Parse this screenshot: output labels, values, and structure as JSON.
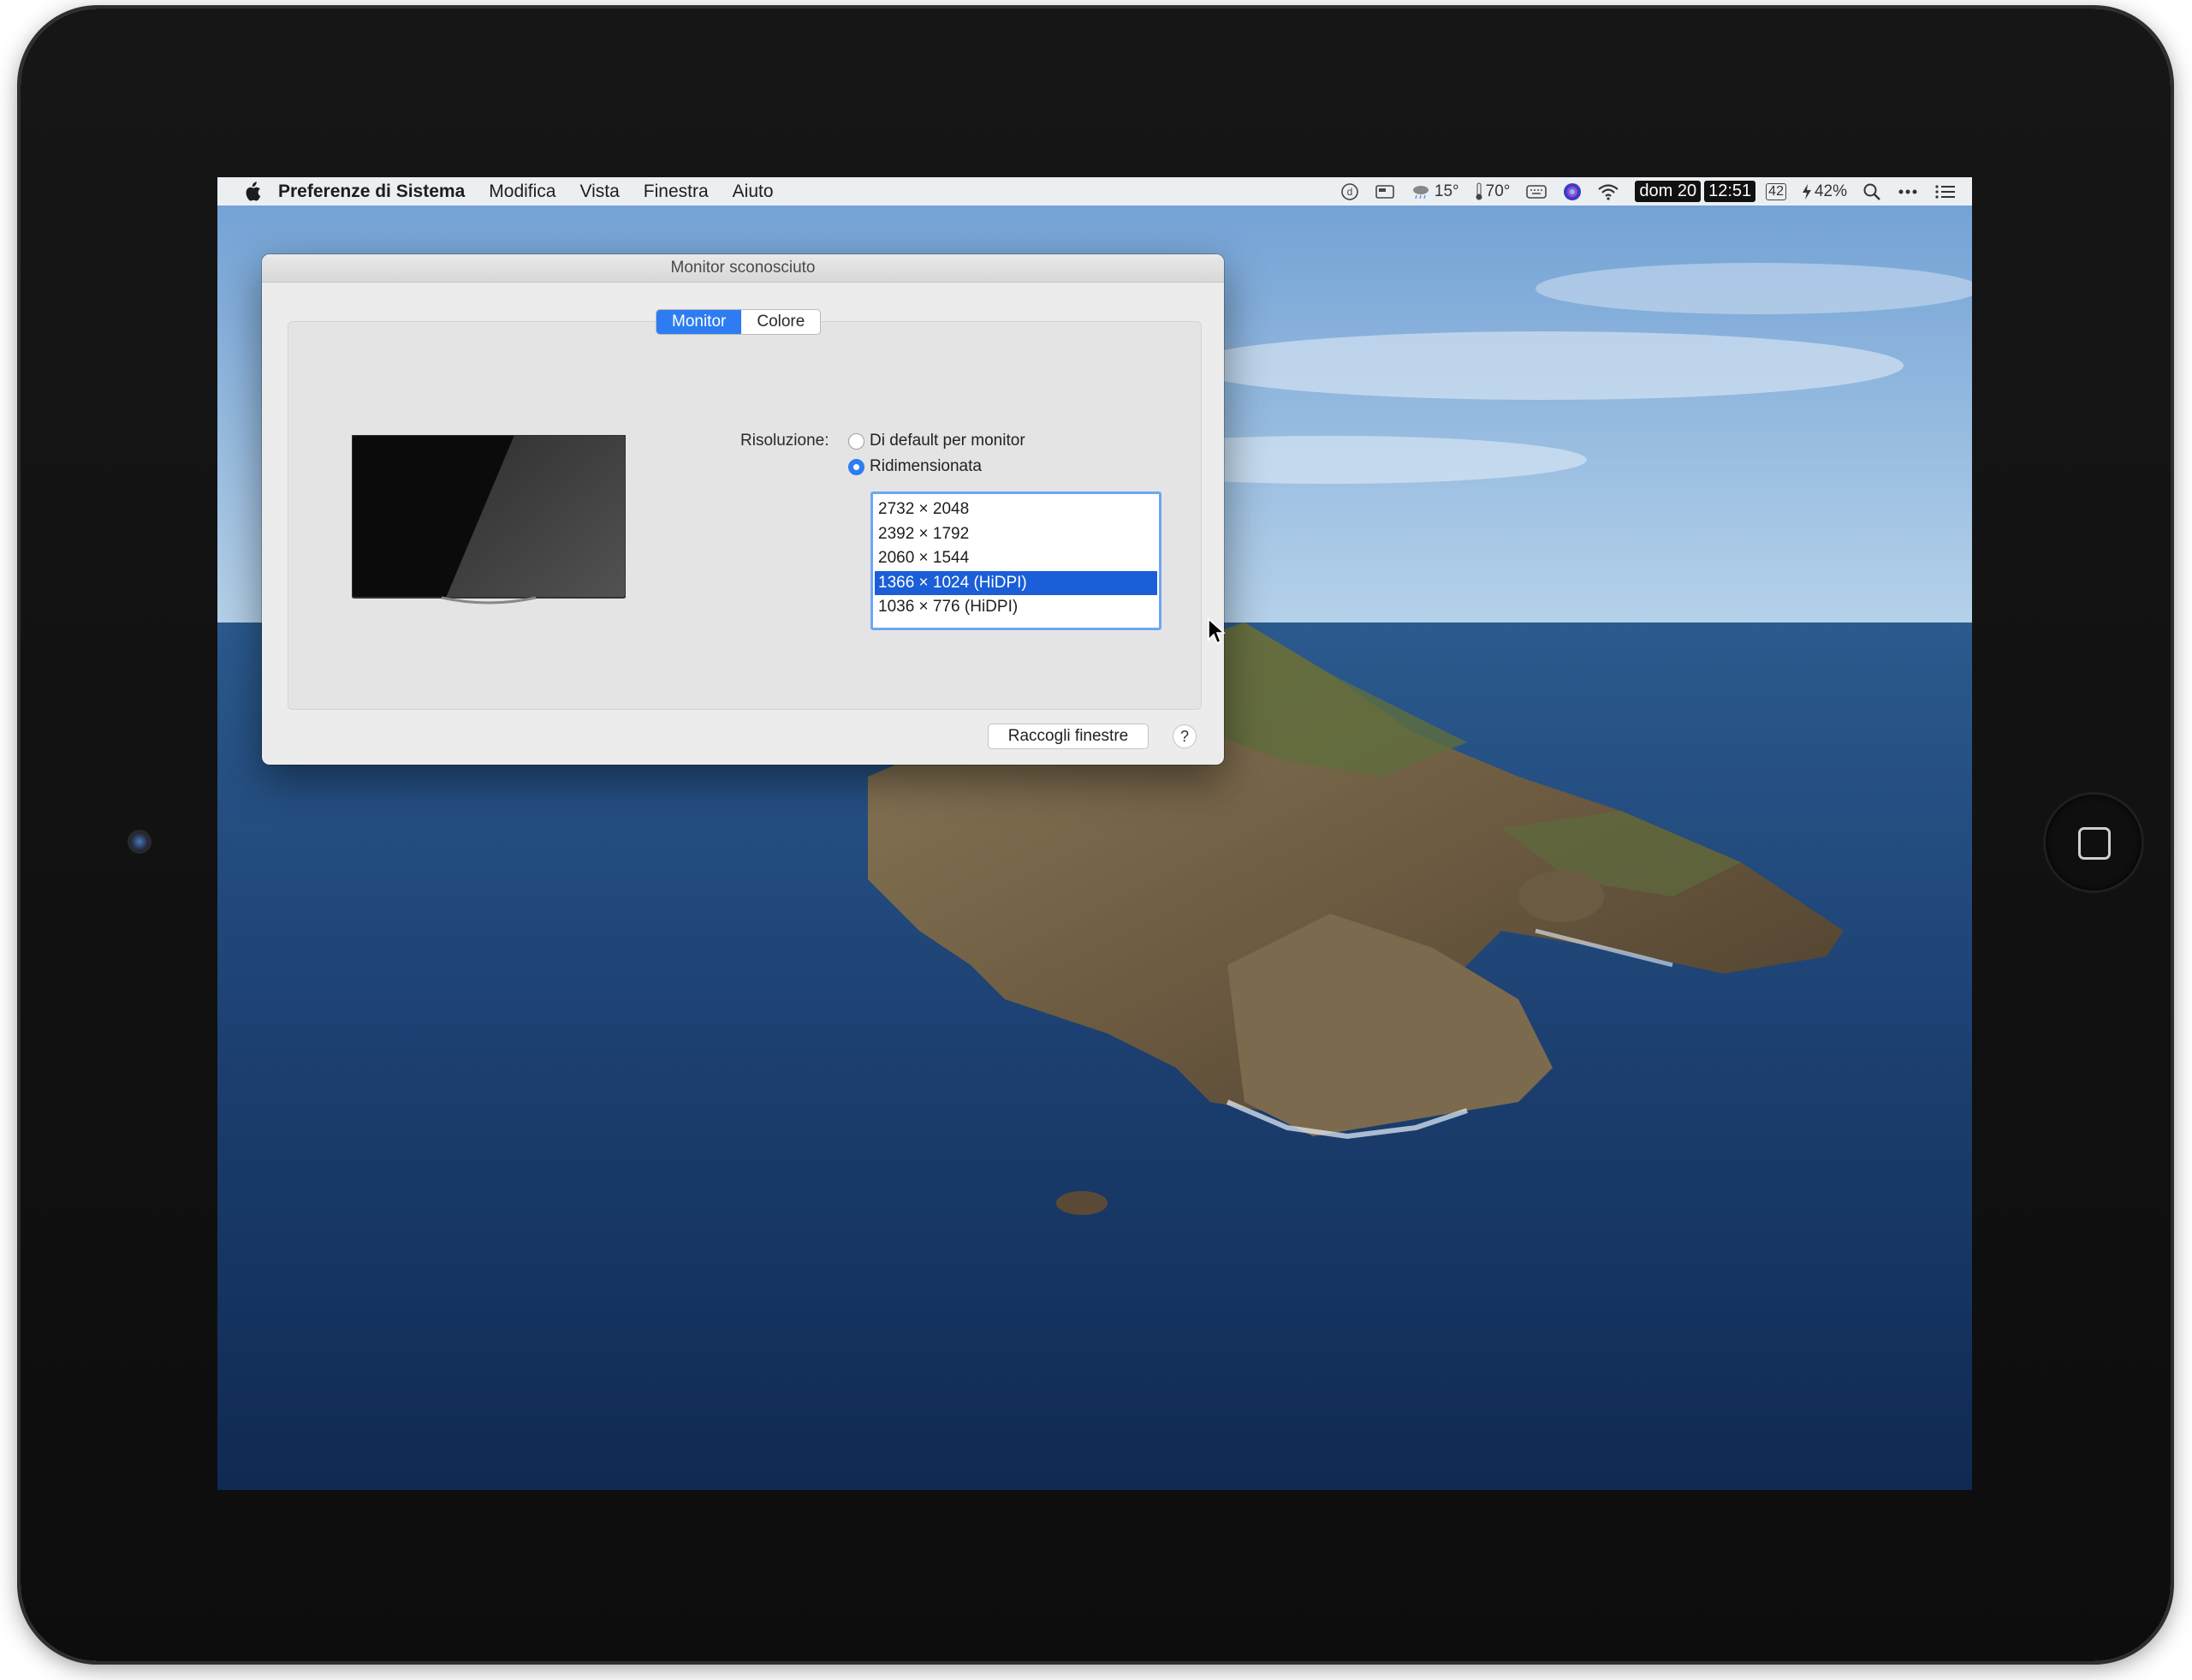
{
  "menubar": {
    "app_name": "Preferenze di Sistema",
    "menus": [
      "Modifica",
      "Vista",
      "Finestra",
      "Aiuto"
    ],
    "status": {
      "weather_temp": "15°",
      "sensor_temp": "70°",
      "date": "dom 20",
      "time": "12:51",
      "calendar_day": "42",
      "battery": "42%"
    }
  },
  "window": {
    "title": "Monitor sconosciuto",
    "tabs": [
      {
        "label": "Monitor",
        "active": true
      },
      {
        "label": "Colore",
        "active": false
      }
    ],
    "resolution_label": "Risoluzione:",
    "options": {
      "default": "Di default per monitor",
      "scaled": "Ridimensionata"
    },
    "selected_option": "scaled",
    "resolutions": [
      "2732 × 2048",
      "2392 × 1792",
      "2060 × 1544",
      "1366 × 1024 (HiDPI)",
      "1036 × 776 (HiDPI)"
    ],
    "selected_resolution": "1366 × 1024 (HiDPI)",
    "gather_button": "Raccogli finestre",
    "help_button": "?"
  },
  "colors": {
    "accent": "#2d7cf2",
    "selection": "#1a5ed8",
    "sea": "#1c3f70"
  }
}
